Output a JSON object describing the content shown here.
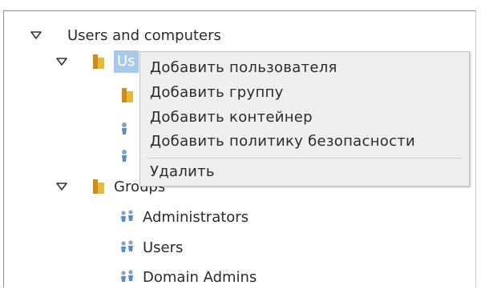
{
  "tree": {
    "root": {
      "label": "Users and computers",
      "expanded": true
    },
    "users_folder": {
      "label": "Users",
      "selected": true,
      "expanded": true,
      "visible_fragment": "Us"
    },
    "groups_folder": {
      "label": "Groups",
      "expanded": true
    },
    "groups": [
      {
        "label": "Administrators",
        "icon": "group-icon"
      },
      {
        "label": "Users",
        "icon": "group-icon"
      },
      {
        "label": "Domain Admins",
        "icon": "group-icon"
      }
    ]
  },
  "context_menu": {
    "items": [
      {
        "label": "Добавить пользователя"
      },
      {
        "label": "Добавить группу"
      },
      {
        "label": "Добавить контейнер"
      },
      {
        "label": "Добавить политику безопасности"
      },
      {
        "label": "Удалить"
      }
    ]
  },
  "colors": {
    "selection": "#a9c9ea",
    "menu_background": "#efefef",
    "folder": "#d9a72b"
  }
}
